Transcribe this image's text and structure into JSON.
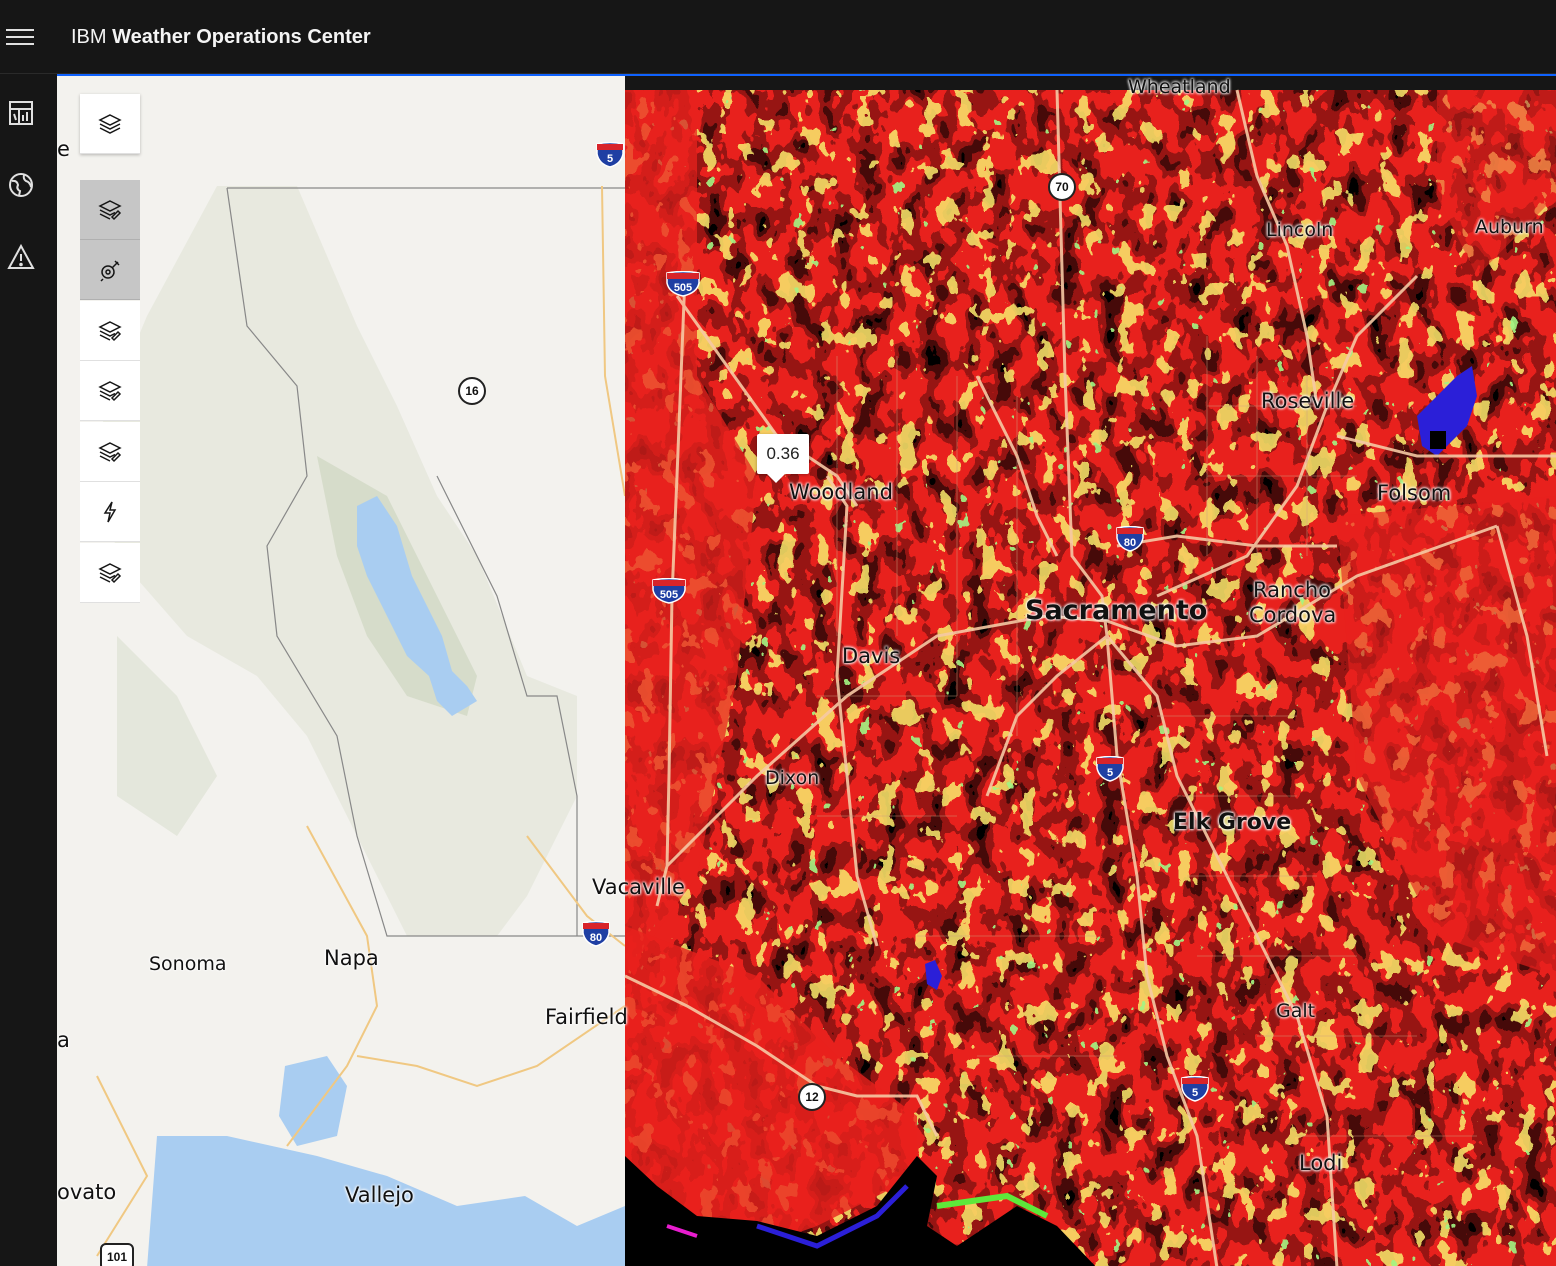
{
  "header": {
    "brand": "IBM",
    "product": "Weather Operations Center"
  },
  "rail": {
    "items": [
      "dashboard-icon",
      "globe-icon",
      "warning-icon"
    ]
  },
  "toolbar": {
    "items": [
      {
        "name": "layers-icon",
        "active": false
      },
      {
        "name": "layer-edit-icon",
        "active": true
      },
      {
        "name": "satellite-icon",
        "active": true
      },
      {
        "name": "layer-edit-icon",
        "active": false
      },
      {
        "name": "layer-edit-icon",
        "active": false
      },
      {
        "name": "layer-edit-icon",
        "active": false
      },
      {
        "name": "lightning-icon",
        "active": false
      },
      {
        "name": "layer-edit-icon",
        "active": false
      }
    ]
  },
  "tooltip": {
    "value": "0.36"
  },
  "cities": {
    "wheatland": "Wheatland",
    "lincoln": "Lincoln",
    "auburn": "Auburn",
    "roseville": "Roseville",
    "woodland": "Woodland",
    "folsom": "Folsom",
    "sacramento": "Sacramento",
    "rancho_cordova_1": "Rancho",
    "rancho_cordova_2": "Cordova",
    "davis": "Davis",
    "dixon": "Dixon",
    "elk_grove": "Elk Grove",
    "vacaville": "Vacaville",
    "sonoma": "Sonoma",
    "napa": "Napa",
    "fairfield": "Fairfield",
    "galt": "Galt",
    "novato": "ovato",
    "vallejo": "Vallejo",
    "lodi": "Lodi",
    "edge_e": "e",
    "edge_a": "a"
  },
  "routes": {
    "i5_top": "5",
    "i505_a": "505",
    "i505_b": "505",
    "i80_east": "80",
    "i80_west": "80",
    "i5_mid": "5",
    "i5_low": "5",
    "sr70": "70",
    "sr16": "16",
    "sr12": "12",
    "us101": "101"
  },
  "colors": {
    "accent": "#0f62fe",
    "header_bg": "#161616",
    "heat_red": "#e8211d",
    "heat_orange": "#f3731f",
    "heat_yellow": "#f2e227",
    "heat_green": "#5ee83a",
    "water": "#a9cdf1"
  }
}
